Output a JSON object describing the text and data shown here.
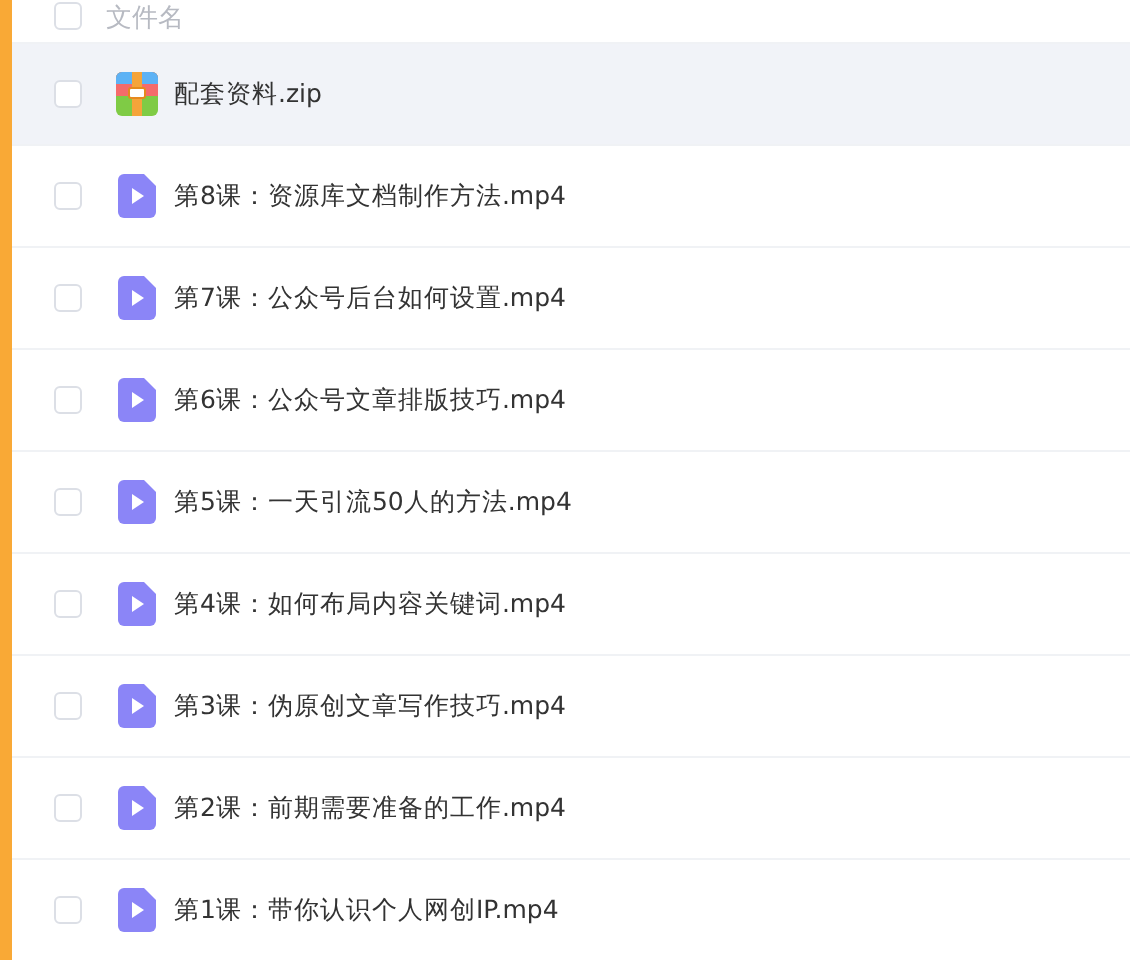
{
  "header": {
    "label": "文件名",
    "checked": false
  },
  "files": [
    {
      "kind": "archive",
      "name": "配套资料.zip",
      "checked": false,
      "highlighted": true
    },
    {
      "kind": "video",
      "name": "第8课：资源库文档制作方法.mp4",
      "checked": false,
      "highlighted": false
    },
    {
      "kind": "video",
      "name": "第7课：公众号后台如何设置.mp4",
      "checked": false,
      "highlighted": false
    },
    {
      "kind": "video",
      "name": "第6课：公众号文章排版技巧.mp4",
      "checked": false,
      "highlighted": false
    },
    {
      "kind": "video",
      "name": "第5课：一天引流50人的方法.mp4",
      "checked": false,
      "highlighted": false
    },
    {
      "kind": "video",
      "name": "第4课：如何布局内容关键词.mp4",
      "checked": false,
      "highlighted": false
    },
    {
      "kind": "video",
      "name": "第3课：伪原创文章写作技巧.mp4",
      "checked": false,
      "highlighted": false
    },
    {
      "kind": "video",
      "name": "第2课：前期需要准备的工作.mp4",
      "checked": false,
      "highlighted": false
    },
    {
      "kind": "video",
      "name": "第1课：带你认识个人网创IP.mp4",
      "checked": false,
      "highlighted": false
    }
  ]
}
